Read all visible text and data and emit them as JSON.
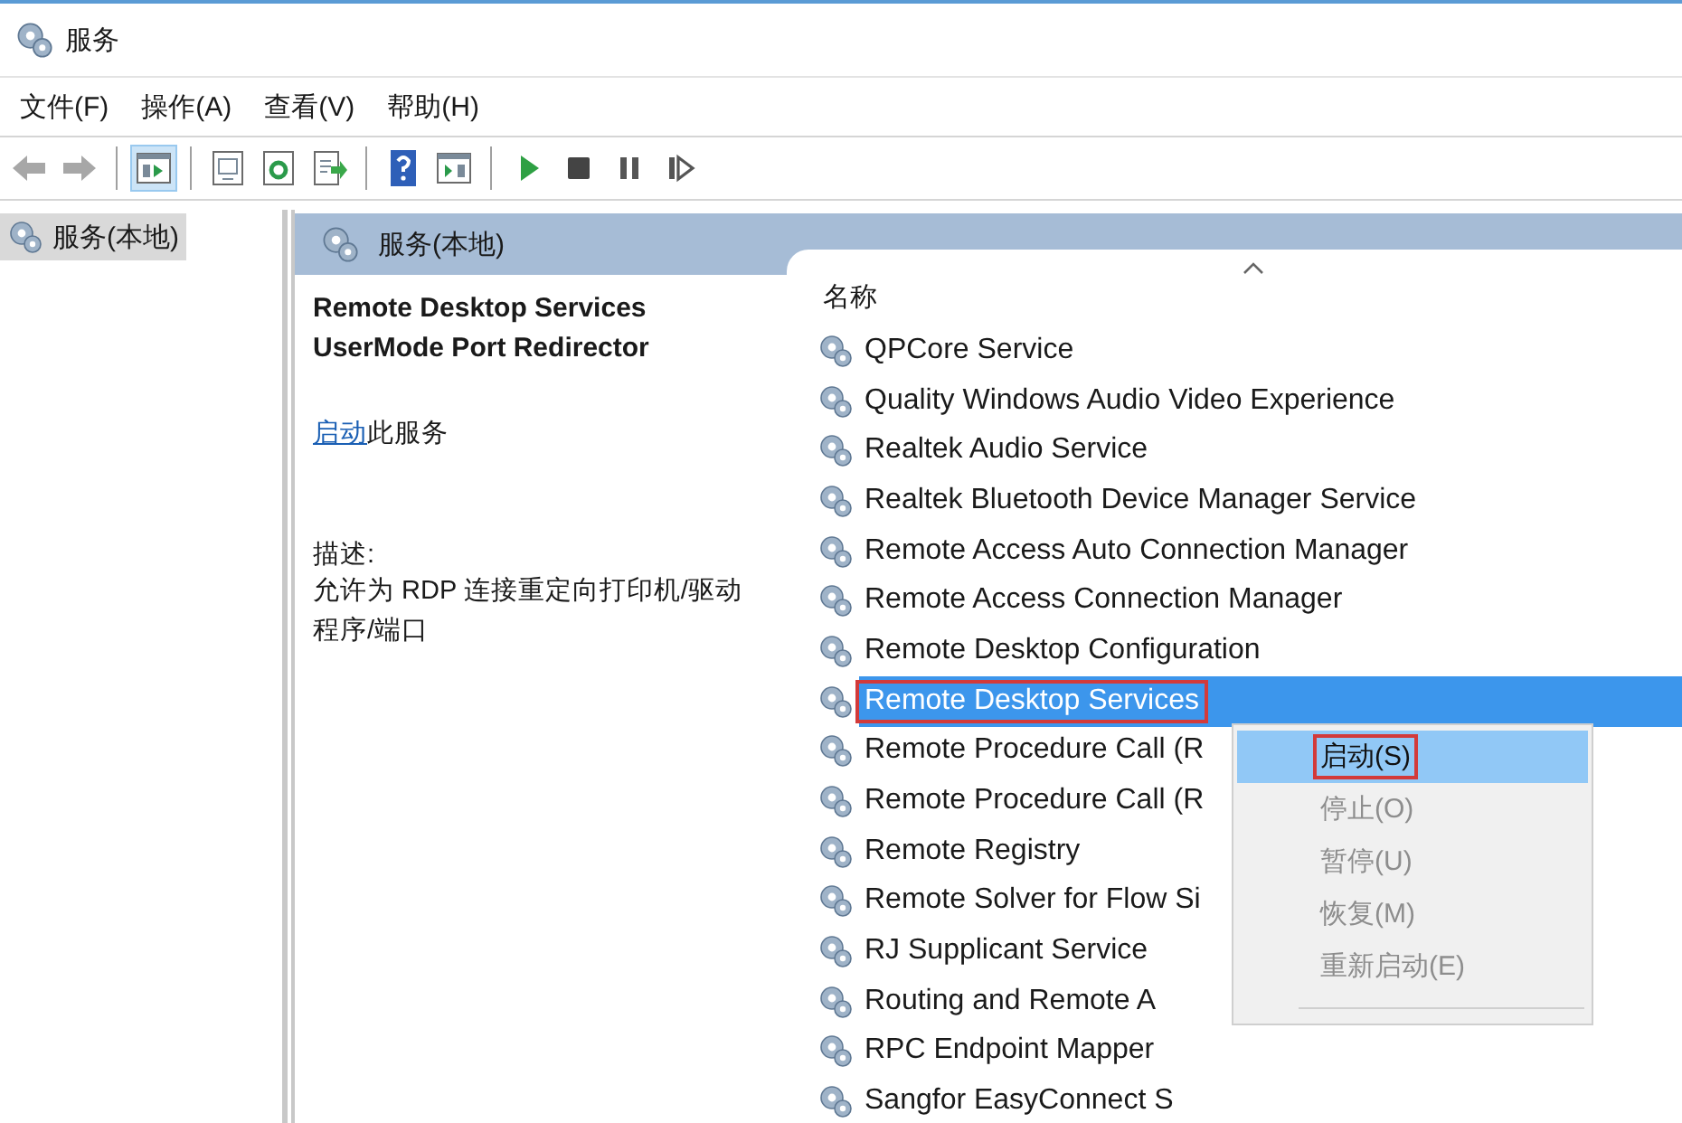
{
  "window": {
    "title": "服务"
  },
  "menu_bar": [
    "文件(F)",
    "操作(A)",
    "查看(V)",
    "帮助(H)"
  ],
  "toolbar": [
    {
      "kind": "back",
      "disabled": true
    },
    {
      "kind": "forward",
      "disabled": true
    },
    {
      "kind": "separator"
    },
    {
      "kind": "tree",
      "pressed": true
    },
    {
      "kind": "separator"
    },
    {
      "kind": "properties",
      "pressed": false
    },
    {
      "kind": "refresh",
      "pressed": false
    },
    {
      "kind": "export",
      "pressed": false
    },
    {
      "kind": "separator"
    },
    {
      "kind": "help",
      "pressed": false
    },
    {
      "kind": "view",
      "pressed": false
    },
    {
      "kind": "separator"
    },
    {
      "kind": "start"
    },
    {
      "kind": "stop"
    },
    {
      "kind": "pause"
    },
    {
      "kind": "resume"
    }
  ],
  "tree": {
    "items": [
      {
        "label": "服务(本地)",
        "selected": true
      }
    ]
  },
  "header": {
    "title": "服务(本地)"
  },
  "details": {
    "service_name": "Remote Desktop Services UserMode Port Redirector",
    "action_link": "启动",
    "action_text": "此服务",
    "description_label": "描述:",
    "description": "允许为 RDP 连接重定向打印机/驱动程序/端口"
  },
  "list": {
    "columns": [
      {
        "label": "名称",
        "sorted": true
      }
    ],
    "rows": [
      {
        "name": "QPCore Service",
        "selected": false,
        "highlighted": false
      },
      {
        "name": "Quality Windows Audio Video Experience",
        "selected": false,
        "highlighted": false
      },
      {
        "name": "Realtek Audio Service",
        "selected": false,
        "highlighted": false
      },
      {
        "name": "Realtek Bluetooth Device Manager Service",
        "selected": false,
        "highlighted": false
      },
      {
        "name": "Remote Access Auto Connection Manager",
        "selected": false,
        "highlighted": false
      },
      {
        "name": "Remote Access Connection Manager",
        "selected": false,
        "highlighted": false
      },
      {
        "name": "Remote Desktop Configuration",
        "selected": false,
        "highlighted": false
      },
      {
        "name": "Remote Desktop Services",
        "selected": true,
        "highlighted": true
      },
      {
        "name": "Remote Procedure Call (R",
        "selected": false,
        "highlighted": false
      },
      {
        "name": "Remote Procedure Call (R",
        "selected": false,
        "highlighted": false
      },
      {
        "name": "Remote Registry",
        "selected": false,
        "highlighted": false
      },
      {
        "name": "Remote Solver for Flow Si",
        "selected": false,
        "highlighted": false
      },
      {
        "name": "RJ Supplicant Service",
        "selected": false,
        "highlighted": false
      },
      {
        "name": "Routing and Remote A",
        "selected": false,
        "highlighted": false
      },
      {
        "name": "RPC Endpoint Mapper",
        "selected": false,
        "highlighted": false
      },
      {
        "name": "Sangfor EasyConnect S",
        "selected": false,
        "highlighted": false
      }
    ]
  },
  "context_menu": {
    "items": [
      {
        "kind": "item",
        "label": "启动(S)",
        "disabled": false,
        "selected": true,
        "highlighted": true
      },
      {
        "kind": "item",
        "label": "停止(O)",
        "disabled": true,
        "selected": false,
        "highlighted": false
      },
      {
        "kind": "item",
        "label": "暂停(U)",
        "disabled": true,
        "selected": false,
        "highlighted": false
      },
      {
        "kind": "item",
        "label": "恢复(M)",
        "disabled": true,
        "selected": false,
        "highlighted": false
      },
      {
        "kind": "item",
        "label": "重新启动(E)",
        "disabled": true,
        "selected": false,
        "highlighted": false
      },
      {
        "kind": "separator"
      }
    ]
  }
}
